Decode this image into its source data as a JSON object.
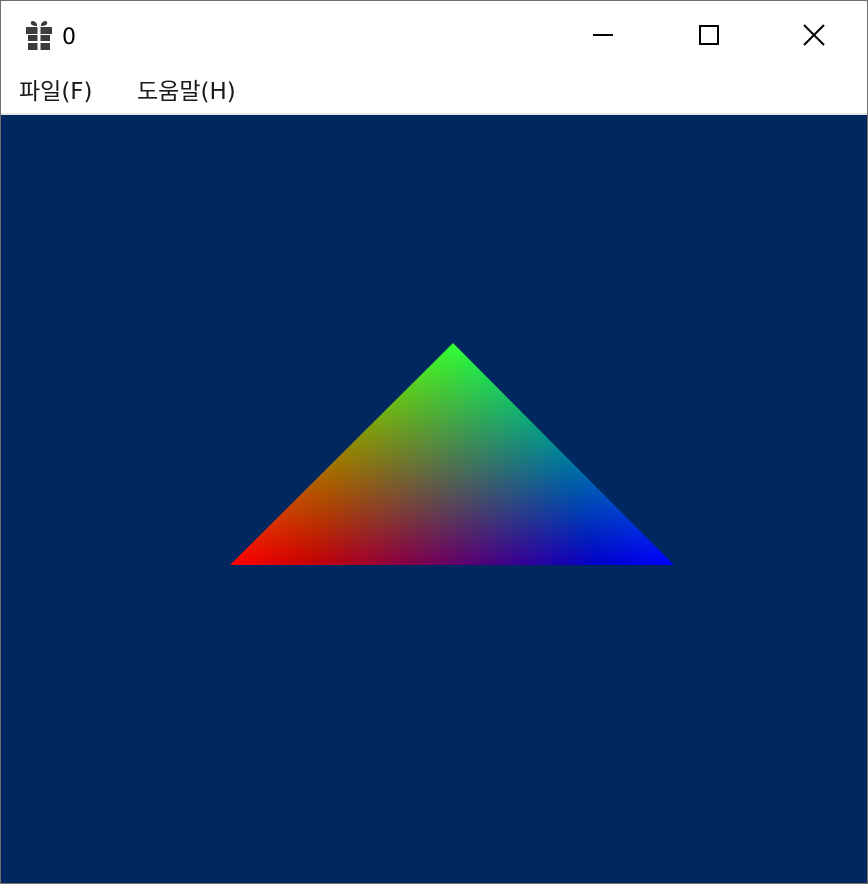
{
  "window": {
    "title": "0",
    "app_icon": "gift-icon",
    "controls": {
      "minimize_icon": "minimize-icon",
      "maximize_icon": "maximize-icon",
      "close_icon": "close-icon"
    }
  },
  "menu": {
    "items": [
      {
        "label": "파일(F)"
      },
      {
        "label": "도움말(H)"
      }
    ]
  },
  "viewport": {
    "clear_color": "#002760",
    "vertex_colors": {
      "top": "#00ff00",
      "bottom_left": "#ff0000",
      "bottom_right": "#0000ff"
    }
  }
}
